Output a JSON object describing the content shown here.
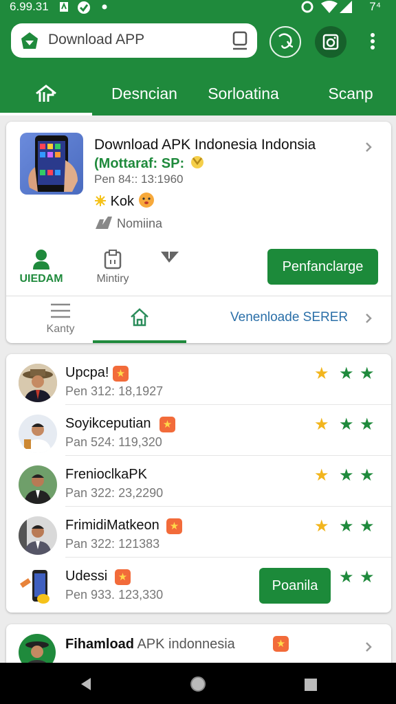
{
  "status_bar": {
    "time": "6.99.31",
    "battery": "7⁴"
  },
  "search": {
    "text": "Download APP"
  },
  "tabs": [
    {
      "label": "Desncian"
    },
    {
      "label": "Sorloatina"
    },
    {
      "label": "Scanp"
    }
  ],
  "featured": {
    "title": "Download APK Indonesia Indonsia",
    "subtitle": "(Mottaraf: SP:",
    "meta": "Pen 84:: 13:1960",
    "kok": "Kok",
    "nomiina": "Nomiina",
    "actions": [
      {
        "label": "UIEDAM",
        "icon": "person-icon"
      },
      {
        "label": "Mintiry",
        "icon": "clipboard-icon"
      },
      {
        "label": "",
        "icon": "send-icon"
      }
    ],
    "primary_button": "Penfanclarge",
    "bottom": {
      "menu_label": "Kanty",
      "link": "Venenloade SERER"
    }
  },
  "list": [
    {
      "name": "Upcpa!",
      "meta": "Pen 312: 18,1927",
      "stars": 3
    },
    {
      "name": "Soyikceputian",
      "meta": "Pan 524: 119,320",
      "stars": 3
    },
    {
      "name": "FrenioclkaPK",
      "meta": "Pan 322: 23,2290",
      "stars": 3
    },
    {
      "name": "FrimidiMatkeon",
      "meta": "Pan 322: 121383",
      "stars": 3
    },
    {
      "name": "Udessi",
      "meta": "Pen 933. 123,330",
      "stars": 2,
      "button": "Poanila"
    }
  ],
  "last_item": {
    "title_bold": "Fihamload",
    "title_rest": " APK indonnesia"
  },
  "colors": {
    "primary": "#1f8a3c",
    "primary_dark": "#16612b",
    "link": "#2a6fa8",
    "star_gold": "#f2b51d",
    "badge": "#f26b3a"
  }
}
